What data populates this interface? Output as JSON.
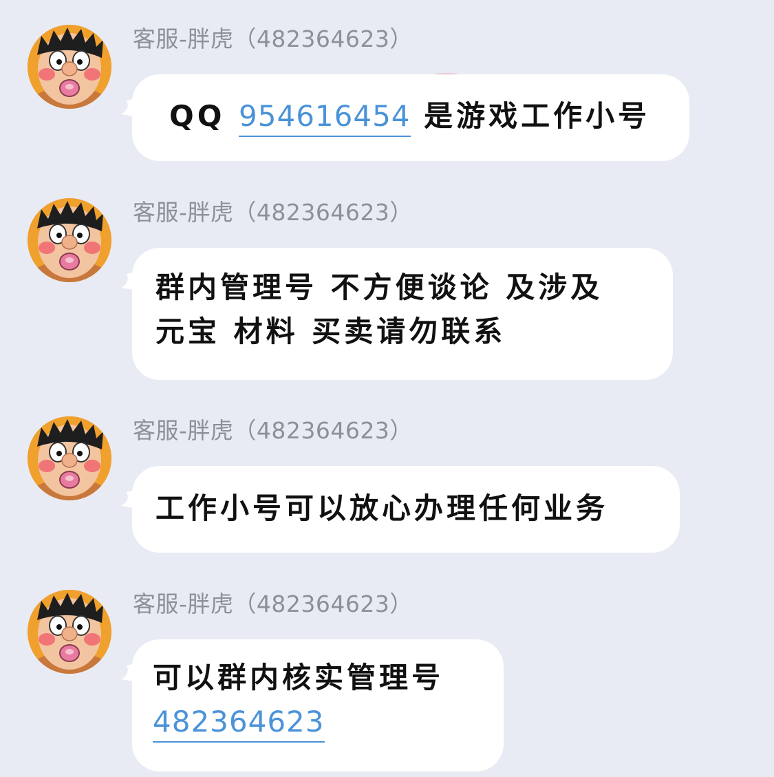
{
  "messages": [
    {
      "sender": "客服-胖虎（482364623）",
      "avatar_icon": "gian-avatar-icon",
      "lines": [
        {
          "parts": [
            {
              "text": "QQ "
            },
            {
              "text": "954616454",
              "link": true
            },
            {
              "text": " 是游戏工作小号"
            }
          ]
        }
      ]
    },
    {
      "sender": "客服-胖虎（482364623）",
      "avatar_icon": "gian-avatar-icon",
      "lines": [
        {
          "parts": [
            {
              "text": "群内管理号 不方便谈论 及涉及"
            }
          ]
        },
        {
          "parts": [
            {
              "text": "元宝  材料 买卖请勿联系"
            }
          ]
        }
      ]
    },
    {
      "sender": "客服-胖虎（482364623）",
      "avatar_icon": "gian-avatar-icon",
      "lines": [
        {
          "parts": [
            {
              "text": "工作小号可以放心办理任何业务"
            }
          ]
        }
      ]
    },
    {
      "sender": "客服-胖虎（482364623）",
      "avatar_icon": "gian-avatar-icon",
      "lines": [
        {
          "parts": [
            {
              "text": "可以群内核实管理号"
            }
          ]
        },
        {
          "parts": [
            {
              "text": "482364623",
              "link": true
            }
          ]
        }
      ]
    }
  ],
  "colors": {
    "background": "#e9ebf4",
    "bubble": "#ffffff",
    "link": "#4b93d8",
    "sender": "#8d9098",
    "highlight_stroke": "#e0322b"
  }
}
